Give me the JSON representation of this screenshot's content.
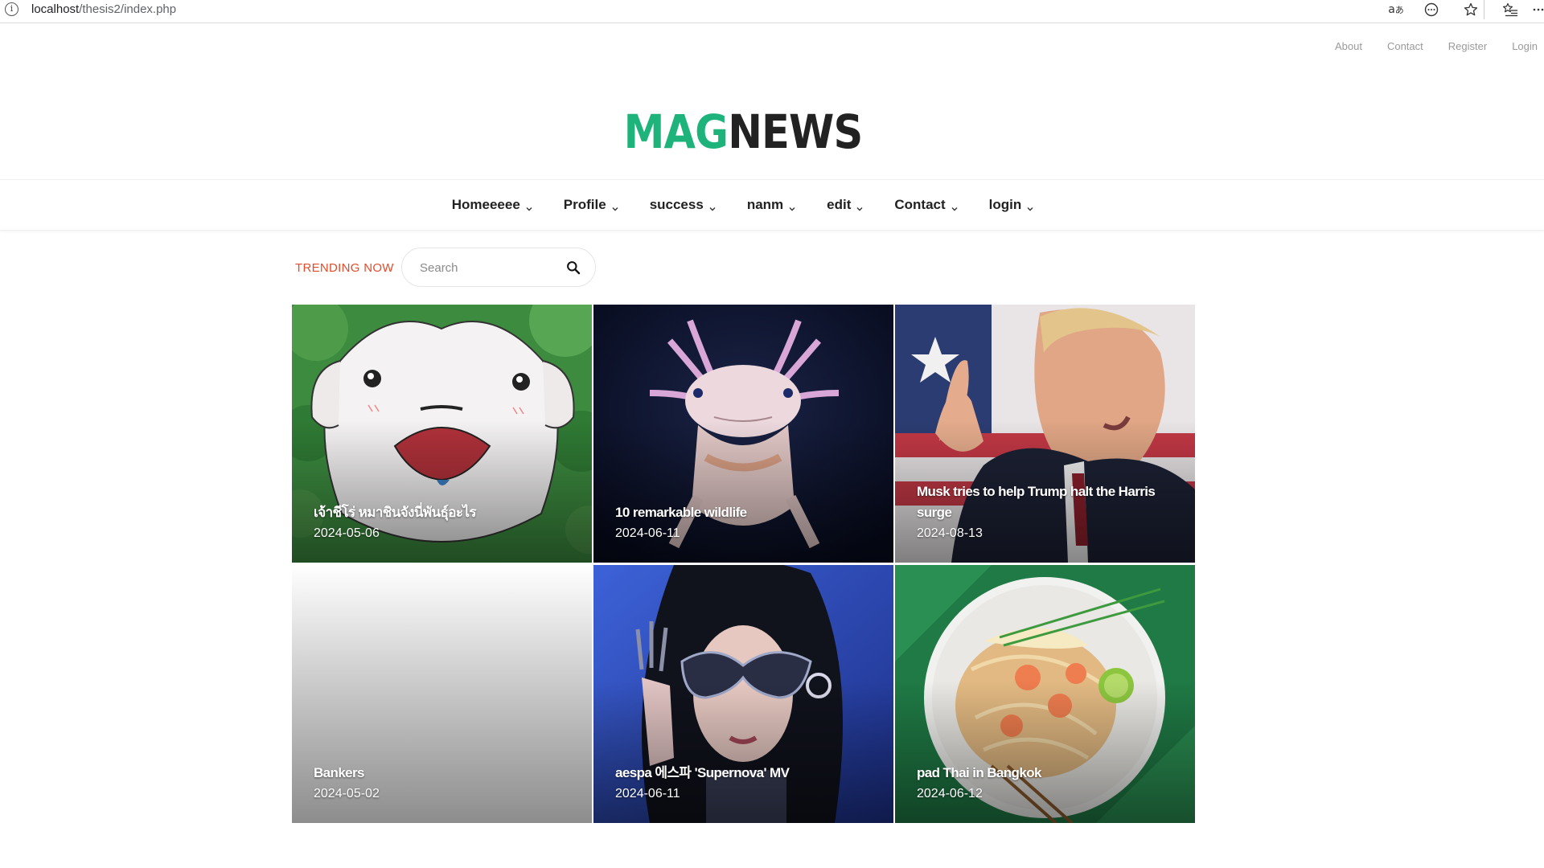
{
  "browser": {
    "url_host": "localhost",
    "url_path": "/thesis2/index.php",
    "icons": [
      "info-icon",
      "read-aloud-icon",
      "more-circle-icon",
      "favorite-star-icon",
      "favorites-list-icon",
      "more-icon"
    ]
  },
  "top_links": [
    "About",
    "Contact",
    "Register",
    "Login"
  ],
  "logo": {
    "part1": "MAG",
    "part2": "NEWS",
    "accent_color": "#1db37a"
  },
  "nav": [
    {
      "label": "Homeeeee"
    },
    {
      "label": "Profile"
    },
    {
      "label": "success"
    },
    {
      "label": "nanm"
    },
    {
      "label": "edit"
    },
    {
      "label": "Contact"
    },
    {
      "label": "login"
    }
  ],
  "trending": {
    "label": "TRENDING NOW",
    "label_color": "#e24c2b",
    "search_placeholder": "Search"
  },
  "posts": [
    {
      "title": "เจ้าชีโร่ หมาชินจังนี่พันธุ์อะไร",
      "date": "2024-05-06"
    },
    {
      "title": "10 remarkable wildlife",
      "date": "2024-06-11"
    },
    {
      "title": "Musk tries to help Trump halt the Harris surge",
      "date": "2024-08-13"
    },
    {
      "title": "Bankers",
      "date": "2024-05-02"
    },
    {
      "title": "aespa 에스파 'Supernova' MV",
      "date": "2024-06-11"
    },
    {
      "title": "pad Thai in Bangkok",
      "date": "2024-06-12"
    }
  ]
}
